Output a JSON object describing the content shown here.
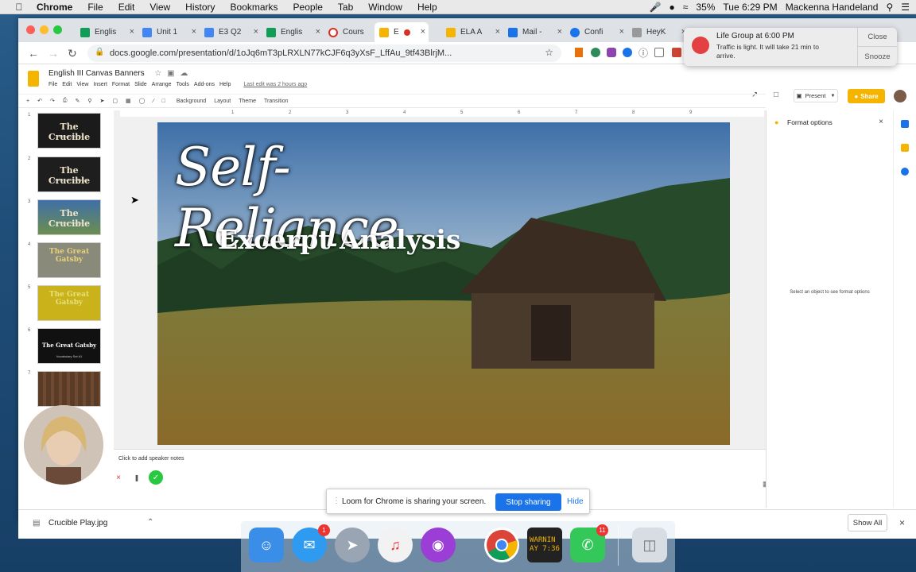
{
  "menubar": {
    "app": "Chrome",
    "items": [
      "File",
      "Edit",
      "View",
      "History",
      "Bookmarks",
      "People",
      "Tab",
      "Window",
      "Help"
    ],
    "battery": "35%",
    "clock": "Tue 6:29 PM",
    "user": "Mackenna Handeland"
  },
  "tabs": [
    {
      "label": "Englis",
      "color": "#0f9d58"
    },
    {
      "label": "Unit 1",
      "color": "#4285f4"
    },
    {
      "label": "E3 Q2",
      "color": "#4285f4"
    },
    {
      "label": "Englis",
      "color": "#0f9d58"
    },
    {
      "label": "Cours",
      "color": "#d93025"
    },
    {
      "label": "E",
      "color": "#f4b400"
    },
    {
      "label": "ELA A",
      "color": "#f4b400"
    },
    {
      "label": "Mail -",
      "color": "#1a73e8"
    },
    {
      "label": "Confi",
      "color": "#1a73e8"
    },
    {
      "label": "HeyK",
      "color": "#777777"
    }
  ],
  "address": {
    "url": "docs.google.com/presentation/d/1oJq6mT3pLRXLN77kCJF6q3yXsF_LffAu_9tf43BlrjM..."
  },
  "notification": {
    "title": "Life Group at 6:00 PM",
    "message": "Traffic is light. It will take 21 min to arrive.",
    "close": "Close",
    "snooze": "Snooze"
  },
  "doc": {
    "title": "English III Canvas Banners",
    "menu": [
      "File",
      "Edit",
      "View",
      "Insert",
      "Format",
      "Slide",
      "Arrange",
      "Tools",
      "Add-ons",
      "Help"
    ],
    "last_edit": "Last edit was 2 hours ago",
    "present": "Present",
    "share": "Share"
  },
  "toolbar": {
    "background": "Background",
    "layout": "Layout",
    "theme": "Theme",
    "transition": "Transition"
  },
  "ruler_marks": [
    "1",
    "2",
    "3",
    "4",
    "5",
    "6",
    "7",
    "8",
    "9"
  ],
  "filmstrip": [
    {
      "num": "1",
      "title": "The Crucible",
      "sub": "Vocabulary Set #1",
      "bg": "#1b1b1b"
    },
    {
      "num": "2",
      "title": "The Crucible",
      "sub": "Critical Close Reading",
      "bg": "#1e1e1e"
    },
    {
      "num": "3",
      "title": "The Crucible",
      "sub": "Character Analysis",
      "bg": "#3f6fa8"
    },
    {
      "num": "4",
      "title": "The Great Gatsby",
      "sub": "",
      "bg": "#8a8a7a"
    },
    {
      "num": "5",
      "title": "The Great Gatsby",
      "sub": "",
      "bg": "#c9b21a"
    },
    {
      "num": "6",
      "title": "The Great Gatsby",
      "sub": "Vocabulary Set #1",
      "bg": "#111111"
    },
    {
      "num": "7",
      "title": "",
      "sub": "",
      "bg": "#5a3b26"
    }
  ],
  "slide": {
    "title": "Self-Reliance",
    "subtitle": "Excerpt Analysis"
  },
  "notes": {
    "placeholder": "Click to add speaker notes"
  },
  "format_panel": {
    "title": "Format options",
    "body": "Select an object to see format options"
  },
  "shelf": {
    "file": "Crucible Play.jpg",
    "show_all": "Show All"
  },
  "loom": {
    "message": "Loom for Chrome is sharing your screen.",
    "stop": "Stop sharing",
    "hide": "Hide"
  },
  "dock": {
    "messages_badge": "1",
    "facetime_badge": "11",
    "console_text": "WARNIN\nAY 7:36"
  }
}
